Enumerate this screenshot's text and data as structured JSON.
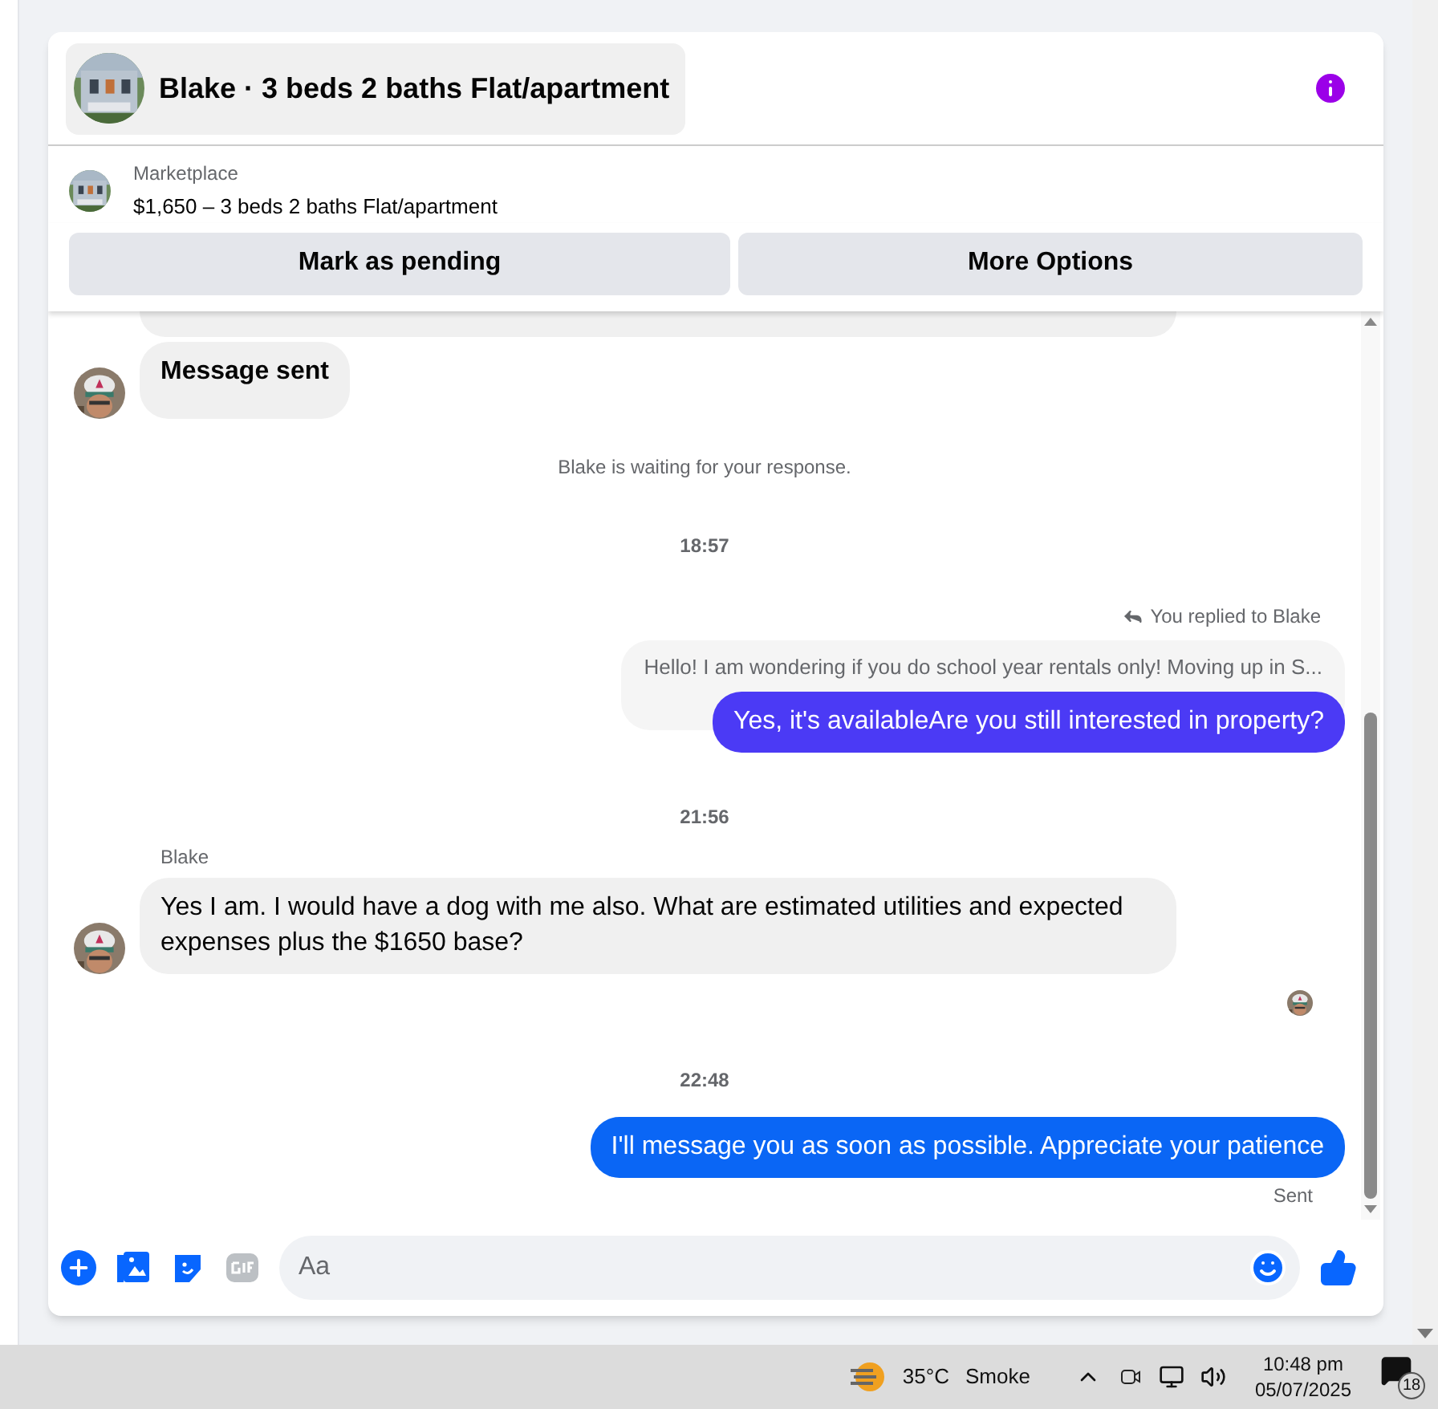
{
  "header": {
    "title": "Blake · 3 beds 2 baths Flat/apartment"
  },
  "listing": {
    "label": "Marketplace",
    "title": "$1,650 – 3 beds 2 baths Flat/apartment"
  },
  "actions": [
    "Mark as pending",
    "More Options"
  ],
  "messages": [
    {
      "kind": "incoming",
      "text": "Message sent",
      "strong": true
    },
    {
      "kind": "note",
      "text": "Blake is waiting for your response."
    },
    {
      "kind": "time",
      "text": "18:57"
    },
    {
      "kind": "reply",
      "label": "You replied to Blake",
      "quoted": "Hello! I am wondering if you do school year rentals only! Moving up in S...",
      "text": "Yes, it's availableAre you still interested in property?",
      "color": "#4b3af5"
    },
    {
      "kind": "time",
      "text": "21:56"
    },
    {
      "kind": "incoming",
      "sender": "Blake",
      "text": "Yes I am. I would have a dog with me also. What are estimated utilities and expected expenses plus the $1650 base?",
      "strong": false
    },
    {
      "kind": "seen"
    },
    {
      "kind": "time",
      "text": "22:48"
    },
    {
      "kind": "outgoing",
      "text": "I'll message you as soon as possible. Appreciate your patience",
      "color": "#0a66f5",
      "status": "Sent"
    }
  ],
  "composer": {
    "placeholder": "Aa"
  },
  "taskbar": {
    "temperature": "35°C",
    "weather": "Smoke",
    "time": "10:48 pm",
    "date": "05/07/2025",
    "notifications": "18"
  }
}
